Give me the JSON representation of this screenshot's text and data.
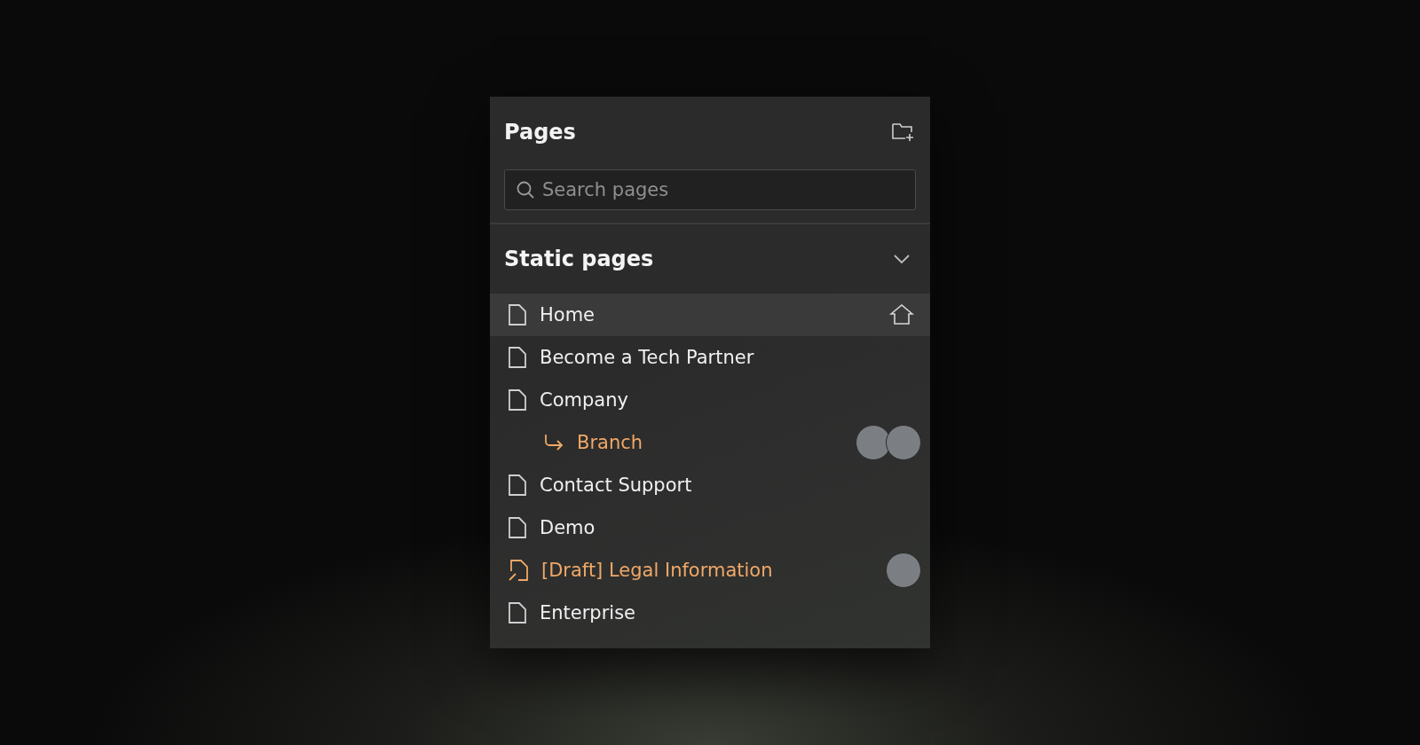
{
  "panel": {
    "title": "Pages"
  },
  "search": {
    "placeholder": "Search pages"
  },
  "section": {
    "title": "Static pages",
    "expanded": true
  },
  "pages": [
    {
      "label": "Home",
      "kind": "page",
      "selected": true,
      "home": true
    },
    {
      "label": "Become a Tech Partner",
      "kind": "page",
      "selected": false,
      "home": false
    },
    {
      "label": "Company",
      "kind": "page",
      "selected": false,
      "home": false,
      "children": [
        {
          "label": "Branch",
          "kind": "branch",
          "selected": false,
          "home": false,
          "viewers": [
            {
              "kind": "avatar"
            },
            {
              "kind": "avatar"
            }
          ]
        }
      ]
    },
    {
      "label": "Contact Support",
      "kind": "page",
      "selected": false,
      "home": false
    },
    {
      "label": "Demo",
      "kind": "page",
      "selected": false,
      "home": false
    },
    {
      "label": "[Draft] Legal Information",
      "kind": "draft",
      "selected": false,
      "home": false,
      "viewers": [
        {
          "kind": "avatar"
        }
      ]
    },
    {
      "label": "Enterprise",
      "kind": "page",
      "selected": false,
      "home": false
    }
  ]
}
